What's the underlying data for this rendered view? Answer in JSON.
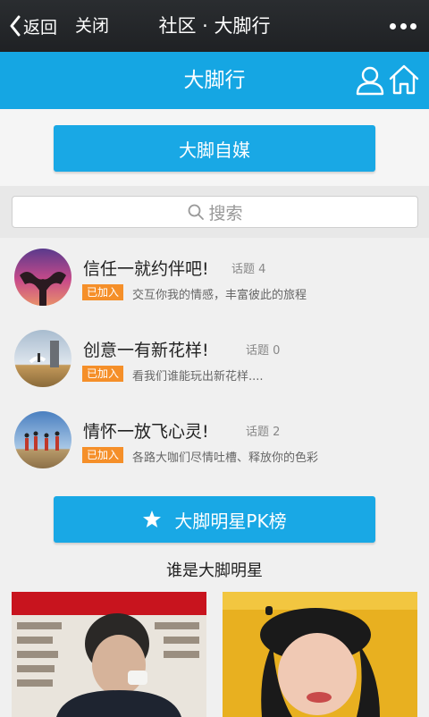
{
  "navbar": {
    "back_label": "返回",
    "close_label": "关闭",
    "title": "社区 · 大脚行",
    "more_icon": "more-dots-icon"
  },
  "header": {
    "title": "大脚行",
    "user_icon": "user-icon",
    "home_icon": "home-icon",
    "color": "#15a6e3"
  },
  "media_button": {
    "label": "大脚自媒"
  },
  "search": {
    "placeholder": "搜索",
    "icon": "search-icon"
  },
  "topics": [
    {
      "title": "信任一就约伴吧!",
      "count": "话题 4",
      "badge": "已加入",
      "desc": "交互你我的情感，丰富彼此的旅程"
    },
    {
      "title": "创意一有新花样!",
      "count": "话题 0",
      "badge": "已加入",
      "desc": "看我们谁能玩出新花样...."
    },
    {
      "title": "情怀一放飞心灵!",
      "count": "话题 2",
      "badge": "已加入",
      "desc": "各路大咖们尽情吐槽、释放你的色彩"
    }
  ],
  "pk_button": {
    "label": "大脚明星PK榜",
    "icon": "star-icon"
  },
  "star_section": {
    "title": "谁是大脚明星"
  },
  "colors": {
    "accent": "#19a8e5",
    "badge": "#f58f29",
    "navbar": "#1f2124"
  }
}
